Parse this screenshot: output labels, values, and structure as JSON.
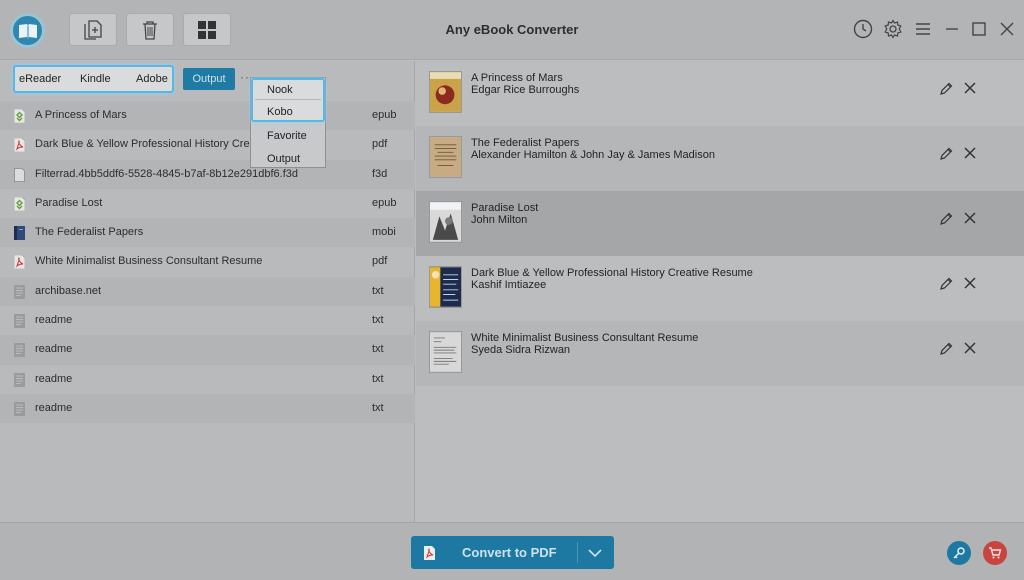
{
  "app": {
    "title": "Any eBook Converter"
  },
  "categories": [
    "eReader",
    "Kindle",
    "Adobe"
  ],
  "output_label": "Output",
  "more_label": "···",
  "dropdown": [
    "Nook",
    "Kobo",
    "Favorite",
    "Output"
  ],
  "files": [
    {
      "name": "A Princess of Mars",
      "ext": "epub",
      "icon": "epub-icon"
    },
    {
      "name": "Dark Blue & Yellow Professional History Creative",
      "ext": "pdf",
      "icon": "pdf-icon"
    },
    {
      "name": "Filterrad.4bb5ddf6-5528-4845-b7af-8b12e291dbf6.f3d",
      "ext": "f3d",
      "icon": "file-icon"
    },
    {
      "name": "Paradise Lost",
      "ext": "epub",
      "icon": "epub-icon"
    },
    {
      "name": "The Federalist Papers",
      "ext": "mobi",
      "icon": "mobi-icon"
    },
    {
      "name": "White Minimalist Business Consultant Resume",
      "ext": "pdf",
      "icon": "pdf-icon"
    },
    {
      "name": "archibase.net",
      "ext": "txt",
      "icon": "txt-icon"
    },
    {
      "name": "readme",
      "ext": "txt",
      "icon": "txt-icon"
    },
    {
      "name": "readme",
      "ext": "txt",
      "icon": "txt-icon"
    },
    {
      "name": "readme",
      "ext": "txt",
      "icon": "txt-icon"
    },
    {
      "name": "readme",
      "ext": "txt",
      "icon": "txt-icon"
    }
  ],
  "books": [
    {
      "title": "A Princess of Mars",
      "author": "Edgar Rice Burroughs"
    },
    {
      "title": "The Federalist Papers",
      "author": "Alexander Hamilton & John Jay & James Madison"
    },
    {
      "title": "Paradise Lost",
      "author": "John Milton"
    },
    {
      "title": "Dark Blue & Yellow Professional History Creative Resume",
      "author": "Kashif Imtiazee"
    },
    {
      "title": "White Minimalist Business Consultant Resume",
      "author": "Syeda Sidra Rizwan"
    }
  ],
  "convert_label": "Convert to PDF",
  "colors": {
    "accent": "#1d78a2",
    "highlight": "#57b7e7",
    "cart": "#c9433f"
  }
}
